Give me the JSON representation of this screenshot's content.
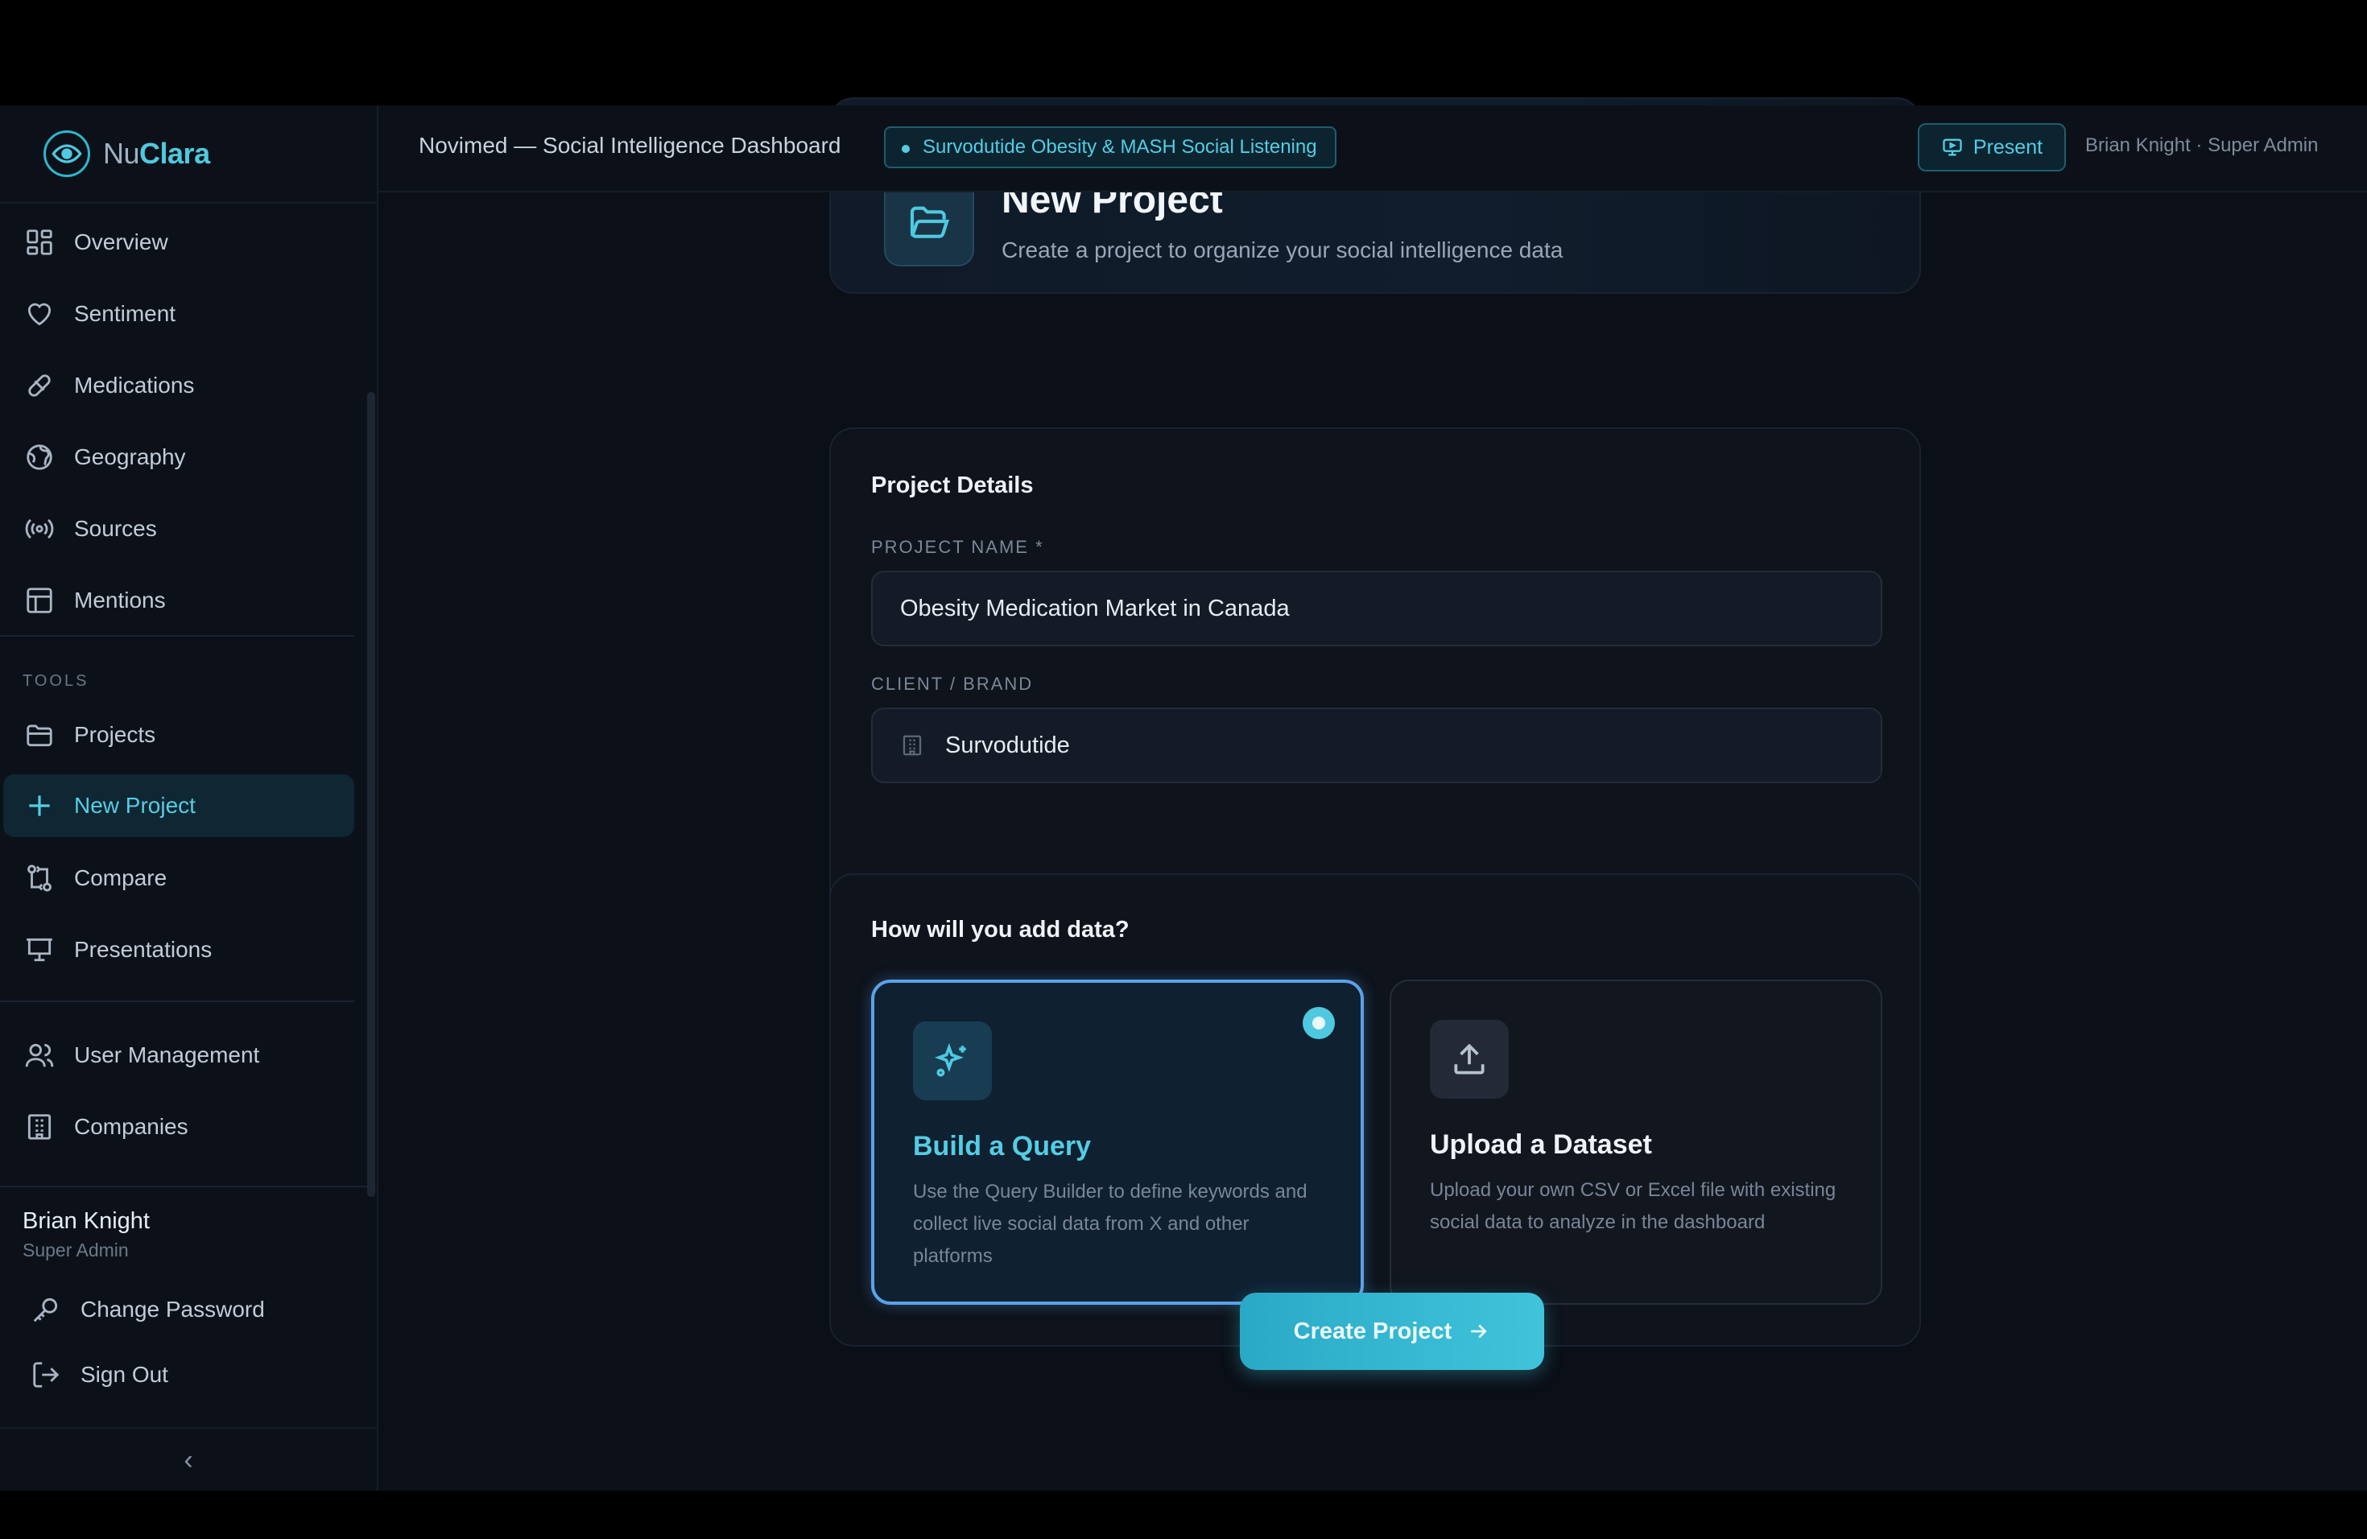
{
  "brand": {
    "prefix": "Nu",
    "suffix": "Clara"
  },
  "sidebar": {
    "nav": [
      {
        "label": "Overview",
        "icon": "grid-icon"
      },
      {
        "label": "Sentiment",
        "icon": "heart-icon"
      },
      {
        "label": "Medications",
        "icon": "pill-icon"
      },
      {
        "label": "Geography",
        "icon": "globe-icon"
      },
      {
        "label": "Sources",
        "icon": "broadcast-icon"
      },
      {
        "label": "Mentions",
        "icon": "table-icon"
      }
    ],
    "tools_label": "TOOLS",
    "tools": [
      {
        "label": "Projects",
        "icon": "folder-icon"
      },
      {
        "label": "New Project",
        "icon": "plus-icon",
        "active": true
      },
      {
        "label": "Compare",
        "icon": "compare-icon"
      },
      {
        "label": "Presentations",
        "icon": "presentation-icon"
      }
    ],
    "admin": [
      {
        "label": "User Management",
        "icon": "users-icon"
      },
      {
        "label": "Companies",
        "icon": "building-icon"
      }
    ],
    "user": {
      "name": "Brian Knight",
      "role": "Super Admin"
    },
    "account": [
      {
        "label": "Change Password",
        "icon": "key-icon"
      },
      {
        "label": "Sign Out",
        "icon": "sign-out-icon"
      }
    ],
    "collapse_glyph": "‹"
  },
  "topbar": {
    "title": "Novimed — Social Intelligence Dashboard",
    "project_badge": "Survodutide Obesity & MASH Social Listening",
    "present_label": "Present",
    "user_info": "Brian Knight · Super Admin"
  },
  "hero": {
    "title": "New Project",
    "subtitle": "Create a project to organize your social intelligence data"
  },
  "details": {
    "heading": "Project Details",
    "project_name_label": "PROJECT NAME *",
    "project_name_value": "Obesity Medication Market in Canada",
    "client_label": "CLIENT / BRAND",
    "client_value": "Survodutide"
  },
  "data_source": {
    "heading": "How will you add data?",
    "options": [
      {
        "title": "Build a Query",
        "description": "Use the Query Builder to define keywords and collect live social data from X and other platforms",
        "selected": true
      },
      {
        "title": "Upload a Dataset",
        "description": "Upload your own CSV or Excel file with existing social data to analyze in the dashboard",
        "selected": false
      }
    ]
  },
  "actions": {
    "create_label": "Create Project"
  },
  "colors": {
    "accent": "#4fc9df",
    "background": "#0b0f17",
    "selected_border": "#5aa2e8"
  }
}
